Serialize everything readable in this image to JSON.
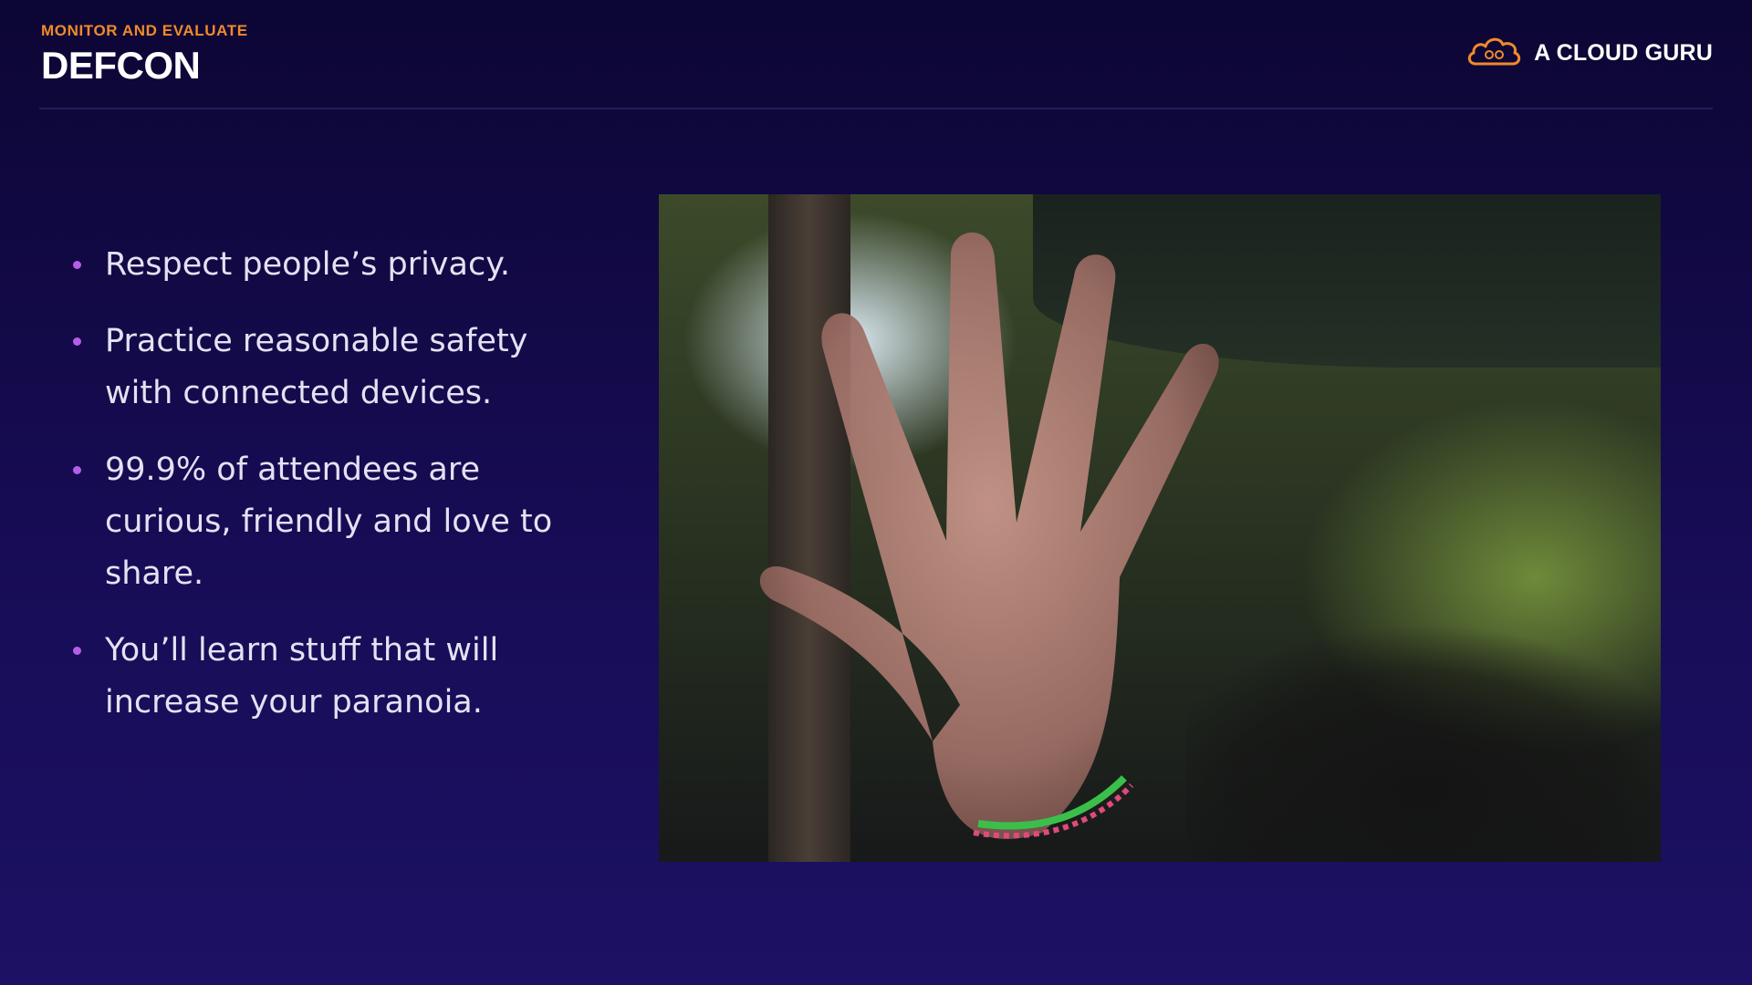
{
  "header": {
    "kicker": "MONITOR AND EVALUATE",
    "title": "DEFCON"
  },
  "brand": {
    "name": "A CLOUD GURU",
    "logo_icon": "cloud-logo-icon",
    "logo_color": "#f08a2a"
  },
  "bullets": [
    "Respect people’s privacy.",
    "Practice reasonable safety with connected devices.",
    "99.9% of attendees are curious, friendly and love to share.",
    "You’ll learn stuff that will increase your paranoia."
  ],
  "colors": {
    "background": "#150b4c",
    "accent_orange": "#f08a2a",
    "bullet_dot": "#b45ee8"
  }
}
